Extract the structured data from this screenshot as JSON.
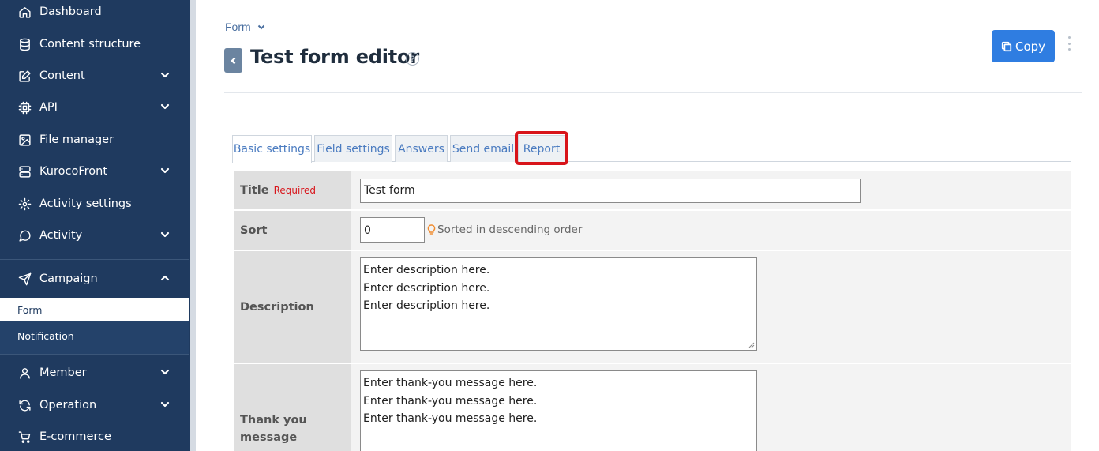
{
  "sidebar": {
    "items": [
      {
        "label": "Dashboard",
        "icon": "home-icon"
      },
      {
        "label": "Content structure",
        "icon": "database-icon"
      },
      {
        "label": "Content",
        "icon": "edit-icon"
      },
      {
        "label": "API",
        "icon": "chip-icon"
      },
      {
        "label": "File manager",
        "icon": "image-icon"
      },
      {
        "label": "KurocoFront",
        "icon": "server-icon"
      },
      {
        "label": "Activity settings",
        "icon": "gear-icon"
      },
      {
        "label": "Activity",
        "icon": "chat-icon"
      },
      {
        "label": "Campaign",
        "icon": "send-icon"
      },
      {
        "label": "Member",
        "icon": "user-icon"
      },
      {
        "label": "Operation",
        "icon": "refresh-icon"
      },
      {
        "label": "E-commerce",
        "icon": "cart-icon"
      }
    ],
    "campaign_sub": [
      "Form",
      "Notification"
    ]
  },
  "header": {
    "breadcrumb": "Form",
    "title": "Test form editor",
    "help_glyph": "?",
    "copy_label": "Copy"
  },
  "tabs": [
    "Basic settings",
    "Field settings",
    "Answers",
    "Send email",
    "Report"
  ],
  "form": {
    "title_label": "Title",
    "required_label": "Required",
    "title_value": "Test form",
    "sort_label": "Sort",
    "sort_value": "0",
    "sort_hint": "Sorted in descending order",
    "description_label": "Description",
    "description_value": "Enter description here.\nEnter description here.\nEnter description here.",
    "thanks_label": "Thank you message",
    "thanks_value": "Enter thank-you message here.\nEnter thank-you message here.\nEnter thank-you message here."
  },
  "colors": {
    "sidebar_bg": "#1f3a5f",
    "primary": "#2f7de1",
    "highlight": "#d8141a",
    "required": "#d8141a"
  }
}
